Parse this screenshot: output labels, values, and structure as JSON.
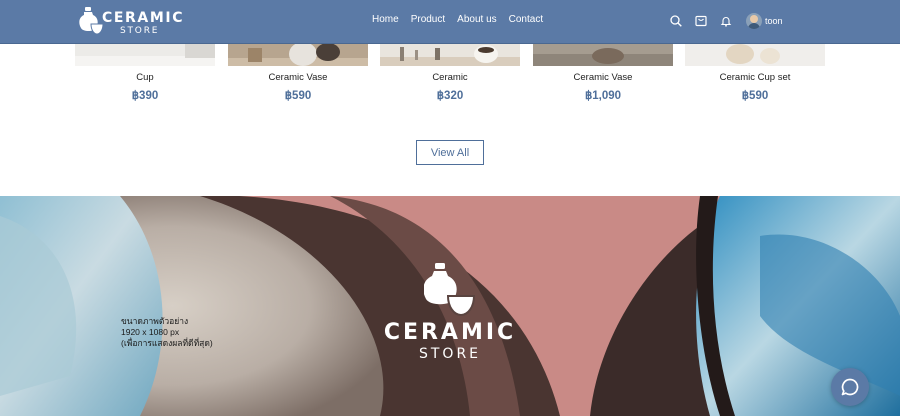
{
  "header": {
    "logo": {
      "title": "CERAMIC",
      "subtitle": "STORE"
    },
    "nav": [
      {
        "label": "Home"
      },
      {
        "label": "Product"
      },
      {
        "label": "About us"
      },
      {
        "label": "Contact"
      }
    ],
    "icons": [
      "search-icon",
      "cart-icon",
      "bell-icon"
    ],
    "user": {
      "name": "toon"
    }
  },
  "products": [
    {
      "name": "Cup",
      "price": "฿390"
    },
    {
      "name": "Ceramic Vase",
      "price": "฿590"
    },
    {
      "name": "Ceramic",
      "price": "฿320"
    },
    {
      "name": "Ceramic Vase",
      "price": "฿1,090"
    },
    {
      "name": "Ceramic Cup set",
      "price": "฿590"
    }
  ],
  "view_all_label": "View All",
  "banner": {
    "note_lines": [
      "ขนาดภาพตัวอย่าง",
      "1920 x 1080 px",
      "(เพื่อการแสดงผลที่ดีที่สุด)"
    ],
    "title": "CERAMIC",
    "subtitle": "STORE"
  },
  "colors": {
    "primary": "#5b7aa6",
    "price": "#4f6f9a",
    "banner_pink": "#c98a86"
  },
  "chat_icon": "chat-bubble-icon"
}
